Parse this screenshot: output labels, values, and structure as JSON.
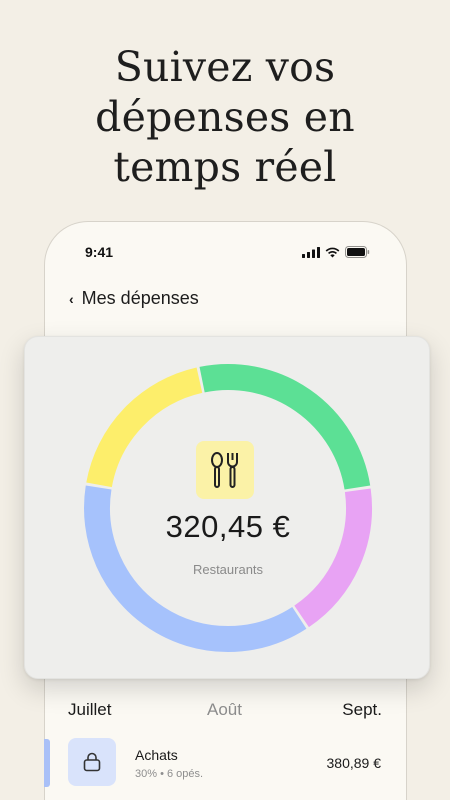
{
  "headline": {
    "line1": "Suivez vos",
    "line2": "dépenses en",
    "line3": "temps réel"
  },
  "status_bar": {
    "time": "9:41",
    "icons": [
      "signal-icon",
      "wifi-icon",
      "battery-icon"
    ]
  },
  "nav": {
    "back_icon": "chevron-left-icon",
    "title": "Mes dépenses"
  },
  "spending_card": {
    "amount": "320,45 €",
    "category": "Restaurants",
    "category_icon": "fork-spoon-icon",
    "category_icon_bg": "#fbf2a7"
  },
  "chart_data": {
    "type": "pie",
    "style": "donut",
    "slices": [
      {
        "color": "#5ce095",
        "fraction": 0.26
      },
      {
        "color": "#e8a3f4",
        "fraction": 0.18
      },
      {
        "color": "#a6c2fc",
        "fraction": 0.37
      },
      {
        "color": "#fdee6b",
        "fraction": 0.19
      }
    ]
  },
  "months": {
    "items": [
      "Juillet",
      "Août",
      "Sept."
    ],
    "selected": "Août"
  },
  "transactions": [
    {
      "title": "Achats",
      "meta": "30%  •  6 opés.",
      "amount": "380,89 €",
      "icon": "lock-icon",
      "icon_bg": "#d9e3fb",
      "accent": "#a9c0f7"
    }
  ]
}
